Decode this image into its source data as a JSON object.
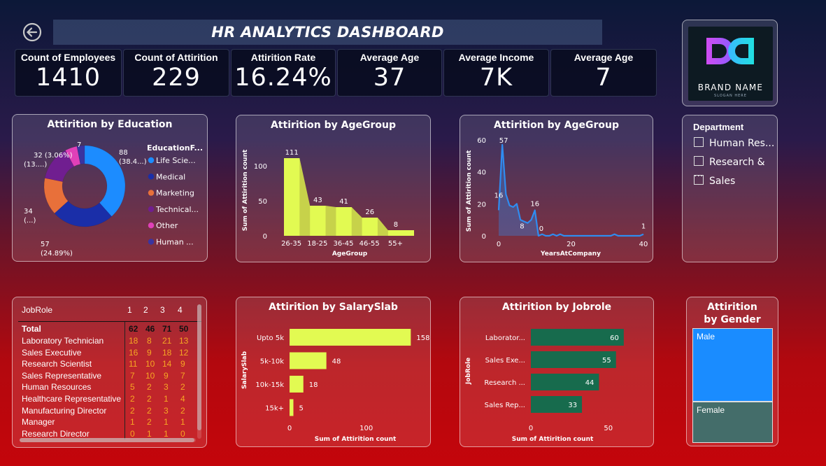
{
  "header": {
    "title": "HR ANALYTICS DASHBOARD",
    "back_icon": "back-arrow-icon"
  },
  "kpis": [
    {
      "label": "Count of Employees",
      "value": "1410"
    },
    {
      "label": "Count of Attirition",
      "value": "229"
    },
    {
      "label": "Attirition Rate",
      "value": "16.24%"
    },
    {
      "label": "Average Age",
      "value": "37"
    },
    {
      "label": "Average Income",
      "value": "7K"
    },
    {
      "label": "Average Age",
      "value": "7"
    }
  ],
  "brand": {
    "name": "BRAND NAME",
    "tagline": "SLOGAN HERE",
    "colors": [
      "#c85cf0",
      "#22d3e6"
    ]
  },
  "slicer": {
    "title": "Department",
    "options": [
      "Human Res...",
      "Research & ...",
      "Sales"
    ]
  },
  "colors": {
    "bar_yellow": "#e2fa52",
    "bar_green": "#176b4d",
    "line_blue": "#2f8cf0",
    "male": "#1a8cff",
    "female": "#446d6a"
  },
  "chart_data": [
    {
      "type": "pie",
      "title": "Attirition by Education",
      "legend_title": "EducationF...",
      "legend_position": "right",
      "categories": [
        "Life Scie...",
        "Medical",
        "Marketing",
        "Technical...",
        "Other",
        "Human ..."
      ],
      "values": [
        88,
        57,
        34,
        32,
        11,
        7
      ],
      "colors": [
        "#1c8cff",
        "#1a2ea8",
        "#e8703a",
        "#701e90",
        "#e040b8",
        "#3a34a0"
      ],
      "data_labels": [
        [
          "88",
          "(38.4...)"
        ],
        [
          "57",
          "(24.89%)"
        ],
        [
          "34",
          "(...)"
        ],
        [
          "32 (3.06%)",
          "(13....)"
        ],
        [
          "",
          ""
        ],
        [
          "7",
          ""
        ]
      ]
    },
    {
      "type": "area",
      "title": "Attirition by AgeGroup",
      "categories": [
        "26-35",
        "18-25",
        "36-45",
        "46-55",
        "55+"
      ],
      "values": [
        111,
        43,
        41,
        26,
        8
      ],
      "xlabel": "AgeGroup",
      "ylabel": "Sum of Attirition count",
      "ylim": [
        0,
        125
      ],
      "yticks": [
        0,
        50,
        100
      ],
      "color": "#e2fa52"
    },
    {
      "type": "line",
      "title": "Attirition by AgeGroup",
      "xlabel": "YearsAtCompany",
      "ylabel": "Sum of Attirition count",
      "xlim": [
        0,
        40
      ],
      "ylim": [
        0,
        60
      ],
      "xticks": [
        0,
        20,
        40
      ],
      "yticks": [
        0,
        20,
        40,
        60
      ],
      "x": [
        0,
        1,
        2,
        3,
        4,
        5,
        6,
        7,
        8,
        9,
        10,
        11,
        12,
        13,
        14,
        15,
        16,
        17,
        18,
        19,
        20,
        21,
        22,
        23,
        24,
        25,
        26,
        27,
        28,
        29,
        30,
        31,
        32,
        33,
        34,
        35,
        36,
        37,
        38,
        39,
        40
      ],
      "values": [
        16,
        57,
        26,
        19,
        18,
        20,
        10,
        9,
        8,
        10,
        16,
        0,
        1,
        0,
        0,
        1,
        0,
        1,
        0,
        0,
        0,
        0,
        0,
        0,
        0,
        0,
        0,
        0,
        0,
        0,
        0,
        0,
        1,
        0,
        0,
        0,
        0,
        0,
        0,
        0,
        1
      ],
      "labels": [
        {
          "x": 0,
          "y": 16,
          "text": "16"
        },
        {
          "x": 1,
          "y": 57,
          "text": "57"
        },
        {
          "x": 8,
          "y": 8,
          "text": "8"
        },
        {
          "x": 10,
          "y": 16,
          "text": "16"
        },
        {
          "x": 11,
          "y": 0,
          "text": "0"
        },
        {
          "x": 40,
          "y": 1,
          "text": "1"
        }
      ],
      "color": "#2f8cf0"
    },
    {
      "type": "bar",
      "title": "Attirition by SalarySlab",
      "orientation": "horizontal",
      "categories": [
        "Upto 5k",
        "5k-10k",
        "10k-15k",
        "15k+"
      ],
      "values": [
        158,
        48,
        18,
        5
      ],
      "xlabel": "Sum of Attirition count",
      "ylabel": "SalarySlab",
      "xlim": [
        0,
        175
      ],
      "xticks": [
        0,
        100
      ],
      "color": "#e2fa52"
    },
    {
      "type": "bar",
      "title": "Attirition by Jobrole",
      "orientation": "horizontal",
      "categories": [
        "Laborator...",
        "Sales Exe...",
        "Research ...",
        "Sales Rep..."
      ],
      "values": [
        60,
        55,
        44,
        33
      ],
      "xlabel": "Sum of Attirition count",
      "ylabel": "JobRole",
      "xlim": [
        0,
        70
      ],
      "xticks": [
        0,
        50
      ],
      "color": "#176b4d"
    },
    {
      "type": "table",
      "columns": [
        "JobRole",
        "1",
        "2",
        "3",
        "4"
      ],
      "total": {
        "label": "Total",
        "values": [
          62,
          46,
          71,
          50
        ]
      },
      "rows": [
        {
          "role": "Laboratory Technician",
          "values": [
            18,
            8,
            21,
            13
          ]
        },
        {
          "role": "Sales Executive",
          "values": [
            16,
            9,
            18,
            12
          ]
        },
        {
          "role": "Research Scientist",
          "values": [
            11,
            10,
            14,
            9
          ]
        },
        {
          "role": "Sales Representative",
          "values": [
            7,
            10,
            9,
            7
          ]
        },
        {
          "role": "Human Resources",
          "values": [
            5,
            2,
            3,
            2
          ]
        },
        {
          "role": "Healthcare Representative",
          "values": [
            2,
            2,
            1,
            4
          ]
        },
        {
          "role": "Manufacturing Director",
          "values": [
            2,
            2,
            3,
            2
          ]
        },
        {
          "role": "Manager",
          "values": [
            1,
            2,
            1,
            1
          ]
        },
        {
          "role": "Research Director",
          "values": [
            0,
            1,
            1,
            0
          ]
        }
      ]
    },
    {
      "type": "treemap",
      "title": "Attirition by Gender",
      "categories": [
        "Male",
        "Female"
      ],
      "values": [
        64,
        36
      ],
      "colors": [
        "#1a8cff",
        "#446d6a"
      ]
    }
  ]
}
